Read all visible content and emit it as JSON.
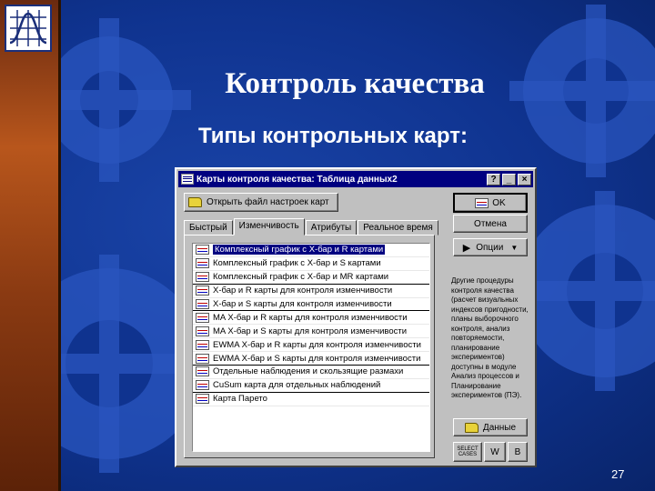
{
  "slide": {
    "title": "Контроль качества",
    "subtitle": "Типы контрольных карт:",
    "page_number": "27"
  },
  "dialog": {
    "title": "Карты контроля качества: Таблица данных2",
    "help_label": "?",
    "minimize_label": "_",
    "close_label": "×",
    "open_file_label": "Открыть файл настроек карт",
    "tabs": [
      {
        "label": "Быстрый",
        "active": false
      },
      {
        "label": "Изменчивость",
        "active": true
      },
      {
        "label": "Атрибуты",
        "active": false
      },
      {
        "label": "Реальное время",
        "active": false
      }
    ],
    "chart_types": [
      {
        "label": "Комплексный график с X-бар и R картами",
        "selected": true,
        "group_end": false
      },
      {
        "label": "Комплексный график с X-бар и S картами",
        "selected": false,
        "group_end": false
      },
      {
        "label": "Комплексный график с X-бар и MR картами",
        "selected": false,
        "group_end": true
      },
      {
        "label": "X-бар и R карты для контроля изменчивости",
        "selected": false,
        "group_end": false
      },
      {
        "label": "X-бар и S карты для контроля изменчивости",
        "selected": false,
        "group_end": true
      },
      {
        "label": "MA X-бар и R карты для контроля изменчивости",
        "selected": false,
        "group_end": false
      },
      {
        "label": "MA X-бар и S карты для контроля изменчивости",
        "selected": false,
        "group_end": false
      },
      {
        "label": "EWMA X-бар и R карты для контроля изменчивости",
        "selected": false,
        "group_end": false
      },
      {
        "label": "EWMA X-бар и S карты для контроля изменчивости",
        "selected": false,
        "group_end": true
      },
      {
        "label": "Отдельные наблюдения и скользящие размахи",
        "selected": false,
        "group_end": false
      },
      {
        "label": "CuSum карта для отдельных наблюдений",
        "selected": false,
        "group_end": true
      },
      {
        "label": "Карта Парето",
        "selected": false,
        "group_end": false
      }
    ],
    "ok_label": "OK",
    "cancel_label": "Отмена",
    "options_label": "Опции",
    "side_note": "Другие процедуры контроля качества (расчет визуальных индексов пригодности, планы выборочного контроля, анализ повторяемости, планирование экспериментов) доступны в модуле Анализ процессов и Планирование экспериментов (ПЭ).",
    "data_label": "Данные",
    "select_cases_label": "SELECT CASES",
    "weight_label": "W",
    "group_label": "B"
  },
  "colors": {
    "titlebar": "#000080",
    "window_face": "#c0c0c0",
    "selection": "#000080",
    "slide_blue": "#0f338f",
    "left_bar": "#b8561c"
  }
}
